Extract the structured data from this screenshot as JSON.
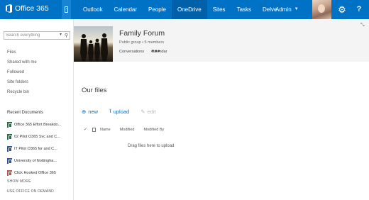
{
  "topbar": {
    "app_name": "Office 365",
    "nav_items": [
      {
        "label": "Outlook"
      },
      {
        "label": "Calendar"
      },
      {
        "label": "People"
      },
      {
        "label": "OneDrive"
      },
      {
        "label": "Sites"
      },
      {
        "label": "Tasks"
      },
      {
        "label": "Delve"
      }
    ],
    "active_item": "OneDrive",
    "admin_label": "Admin",
    "help_label": "?",
    "icons": [
      "office-logo-icon",
      "phone-icon",
      "chevron-down-icon",
      "gear-icon",
      "help-icon"
    ],
    "brand_color": "#0072c6"
  },
  "sidebar": {
    "search_placeholder": "Search everything",
    "links": [
      {
        "label": "Files"
      },
      {
        "label": "Shared with me"
      },
      {
        "label": "Followed"
      },
      {
        "label": "Site folders"
      },
      {
        "label": "Recycle bin"
      }
    ],
    "recent_title": "Recent Documents",
    "recent_docs": [
      {
        "label": "Office 365 Effort Breakdo...",
        "icon": "excel-icon"
      },
      {
        "label": "02 Pilot O365 Svc and C...",
        "icon": "excel-icon"
      },
      {
        "label": "IT Pilot O365 for and C...",
        "icon": "word-icon"
      },
      {
        "label": "University of Nottingha...",
        "icon": "word-icon"
      },
      {
        "label": "Click Hooked Office 365",
        "icon": "ppt-icon"
      }
    ],
    "show_more": "SHOW MORE",
    "use_office": "USE OFFICE ON DEMAND"
  },
  "group": {
    "name": "Family Forum",
    "meta": "Public group • 5 members",
    "tabs": [
      {
        "label": "Conversations"
      },
      {
        "label": "Calendar"
      }
    ],
    "more_label": "•••"
  },
  "files": {
    "title": "Our files",
    "new_label": "new",
    "upload_label": "upload",
    "edit_label": "edit",
    "columns": [
      {
        "label": "Name"
      },
      {
        "label": "Modified"
      },
      {
        "label": "Modified By"
      }
    ],
    "empty_message": "Drag files here to upload"
  }
}
